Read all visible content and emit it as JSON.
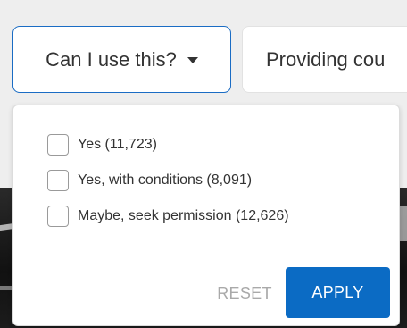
{
  "filters": {
    "usage_label": "Can I use this?",
    "second_label": "Providing cou"
  },
  "dropdown": {
    "options": [
      {
        "label": "Yes (11,723)",
        "checked": false
      },
      {
        "label": "Yes, with conditions (8,091)",
        "checked": false
      },
      {
        "label": "Maybe, seek permission (12,626)",
        "checked": false
      }
    ],
    "reset_label": "RESET",
    "apply_label": "APPLY"
  },
  "colors": {
    "accent": "#0b6bc4",
    "active_border": "#1a6cc4",
    "muted_text": "#a9a9a9",
    "background": "#eeeeee"
  }
}
